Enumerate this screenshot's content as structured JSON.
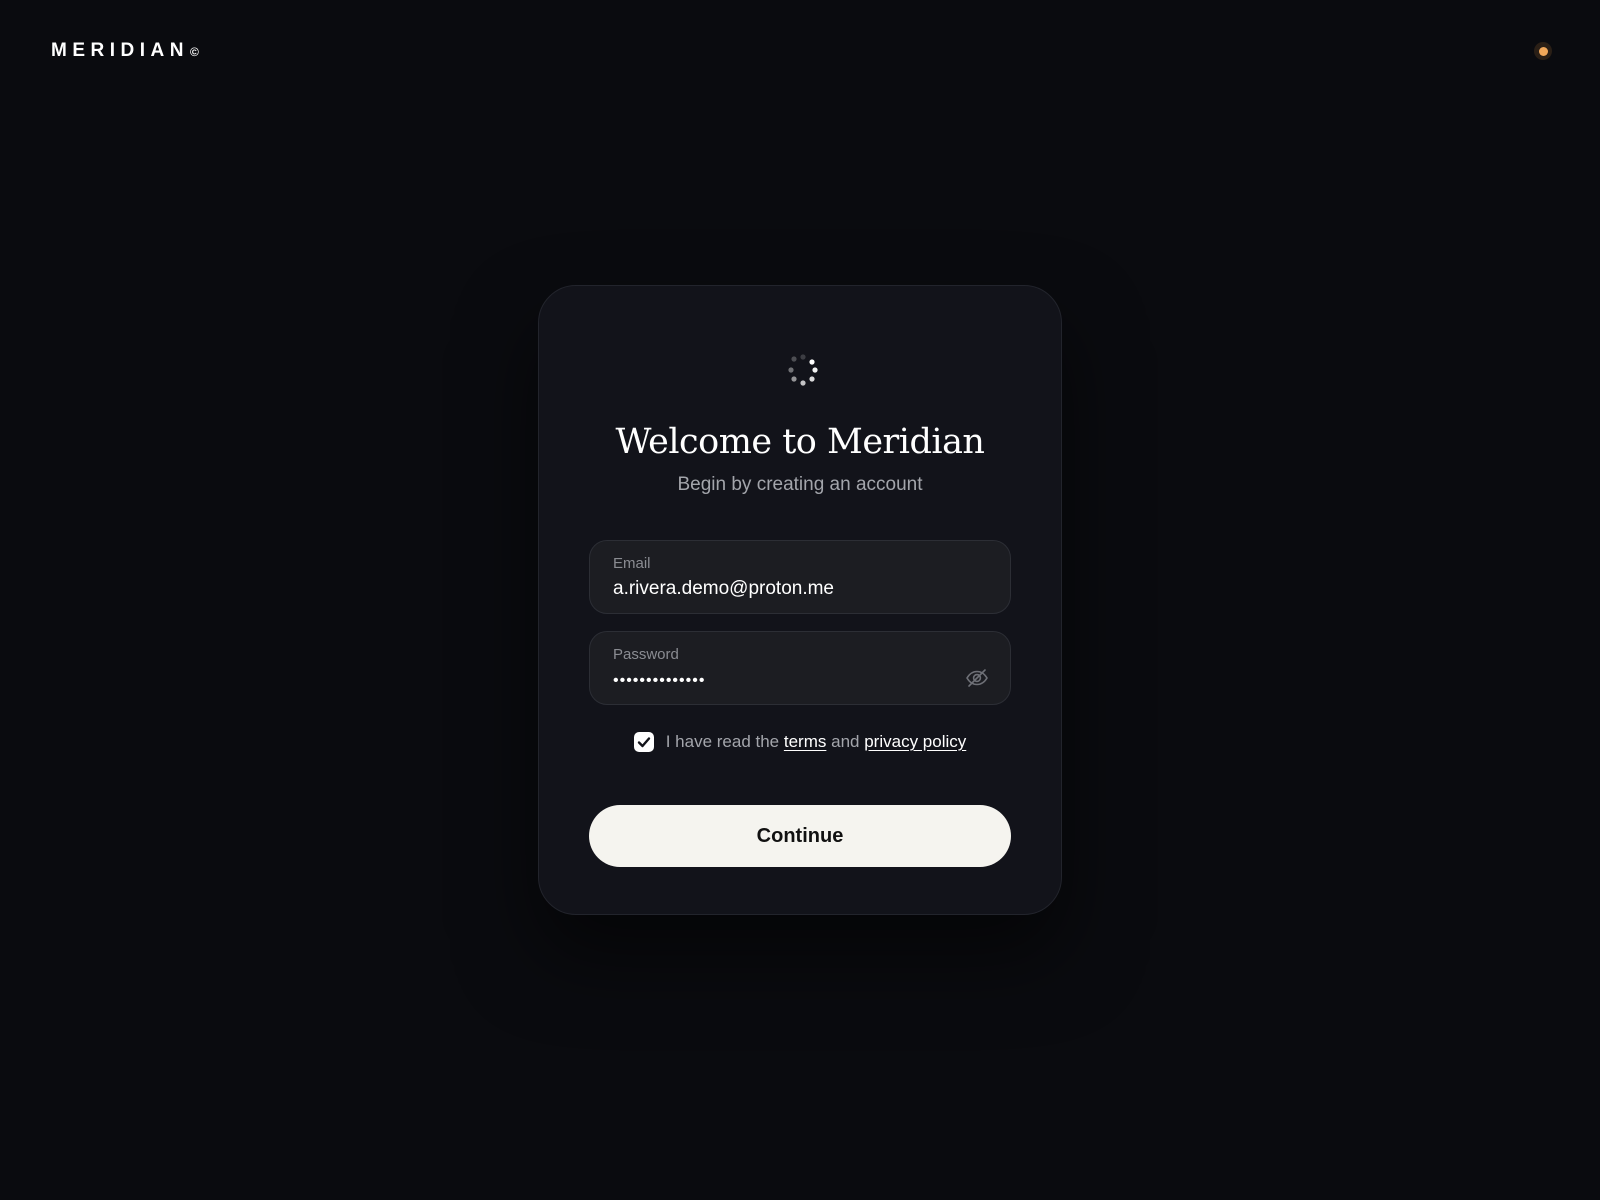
{
  "header": {
    "logo_text": "MERIDIAN",
    "logo_mark": "©",
    "status_indicator_color": "#f0a75a"
  },
  "card": {
    "title": "Welcome to Meridian",
    "subtitle": "Begin by creating an account",
    "email": {
      "label": "Email",
      "value": "a.rivera.demo@proton.me"
    },
    "password": {
      "label": "Password",
      "value": "••••••••••••••",
      "toggle_icon": "eye-off-icon"
    },
    "consent": {
      "checked": true,
      "prefix": "I have read the",
      "terms_link": "terms",
      "joiner": "and",
      "privacy_link": "privacy policy"
    },
    "continue_label": "Continue",
    "spinner_icon": "loading-spinner-icon"
  },
  "colors": {
    "background": "#0a0b0f",
    "card": "#12131a",
    "button": "#f5f4ef"
  }
}
